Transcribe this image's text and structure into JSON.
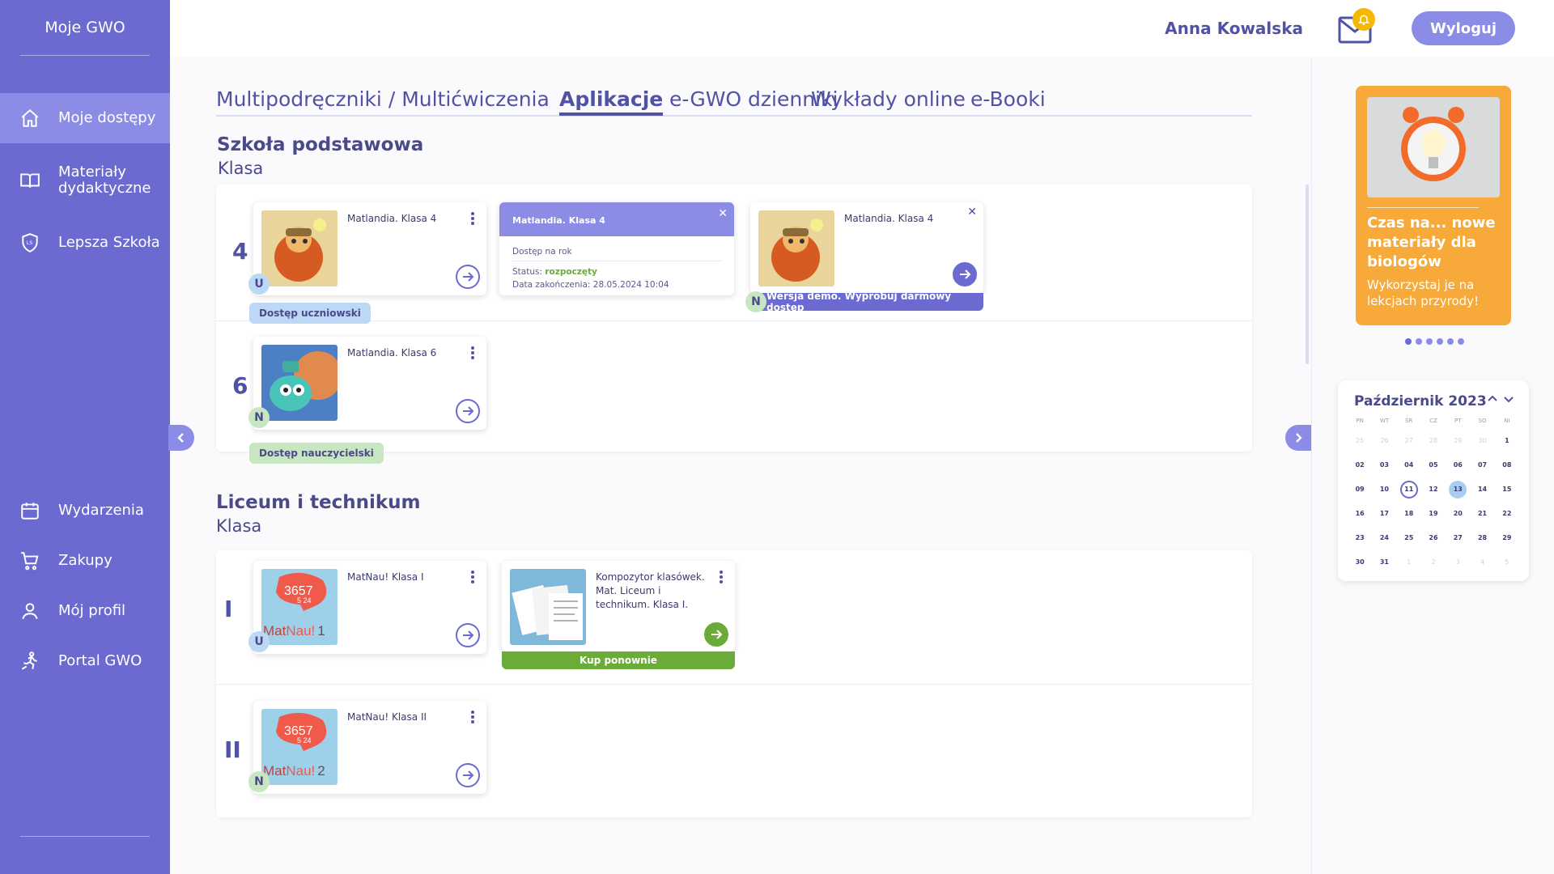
{
  "brand": "Moje GWO",
  "sidebar": {
    "items": [
      {
        "label": "Moje dostępy",
        "icon": "home-icon",
        "active": true
      },
      {
        "label": "Materiały dydaktyczne",
        "icon": "book-icon"
      },
      {
        "label": "Lepsza Szkoła",
        "icon": "shield-icon"
      },
      {
        "label": "Wydarzenia",
        "icon": "calendar-icon"
      },
      {
        "label": "Zakupy",
        "icon": "cart-icon"
      },
      {
        "label": "Mój profil",
        "icon": "user-icon"
      },
      {
        "label": "Portal GWO",
        "icon": "runner-icon"
      }
    ]
  },
  "header": {
    "user_name": "Anna Kowalska",
    "logout_label": "Wyloguj"
  },
  "tabs": [
    {
      "label": "Multipodręczniki / Multićwiczenia"
    },
    {
      "label": "Aplikacje",
      "active": true
    },
    {
      "label": "e-GWO dzienniki"
    },
    {
      "label": "Wykłady online"
    },
    {
      "label": "e-Booki"
    }
  ],
  "sections": {
    "primary": {
      "title": "Szkoła podstawowa",
      "subtitle": "Klasa",
      "rows": [
        {
          "grade": "4",
          "cards": [
            {
              "title": "Matlandia. Klasa 4",
              "letter": "U",
              "badge": "Dostęp uczniowski"
            },
            {
              "title": "Matlandia. Klasa 4",
              "letter": "N",
              "ribbon": "Wersja demo. Wypróbuj darmowy dostęp"
            }
          ],
          "popover": {
            "title": "Matlandia. Klasa 4",
            "access": "Dostęp na rok",
            "status_label": "Status:",
            "status_value": "rozpoczęty",
            "end_label": "Data zakończenia:",
            "end_value": "28.05.2024 10:04"
          }
        },
        {
          "grade": "6",
          "cards": [
            {
              "title": "Matlandia. Klasa 6",
              "letter": "N",
              "badge": "Dostęp  nauczycielski"
            }
          ]
        }
      ]
    },
    "secondary": {
      "title": "Liceum i technikum",
      "subtitle": "Klasa",
      "rows": [
        {
          "grade": "I",
          "cards": [
            {
              "title": "MatNau! Klasa I",
              "letter": "U",
              "thumb_text": {
                "top": "3657",
                "mid": "5 24",
                "brand1": "Mat",
                "brand2": "Nau!",
                "num": "1"
              }
            },
            {
              "title": "Kompozytor klasówek. Mat. Liceum i technikum. Klasa I.",
              "ribbon": "Kup ponownie"
            }
          ]
        },
        {
          "grade": "II",
          "cards": [
            {
              "title": "MatNau! Klasa II",
              "letter": "N",
              "thumb_text": {
                "top": "3657",
                "mid": "5 24",
                "brand1": "Mat",
                "brand2": "Nau!",
                "num": "2"
              }
            }
          ]
        }
      ]
    }
  },
  "promo": {
    "title": "Czas na... nowe materiały dla biologów",
    "text": "Wykorzystaj je na lekcjach przyrody!",
    "dots": 6
  },
  "calendar": {
    "title": "Październik 2023",
    "weekdays": [
      "PN",
      "WT",
      "ŚR",
      "CZ",
      "PT",
      "SO",
      "NI"
    ],
    "days": [
      {
        "d": "25",
        "m": true
      },
      {
        "d": "26",
        "m": true
      },
      {
        "d": "27",
        "m": true
      },
      {
        "d": "28",
        "m": true
      },
      {
        "d": "29",
        "m": true
      },
      {
        "d": "30",
        "m": true
      },
      {
        "d": "1"
      },
      {
        "d": "02"
      },
      {
        "d": "03"
      },
      {
        "d": "04"
      },
      {
        "d": "05"
      },
      {
        "d": "06"
      },
      {
        "d": "07"
      },
      {
        "d": "08"
      },
      {
        "d": "09"
      },
      {
        "d": "10"
      },
      {
        "d": "11",
        "today": true
      },
      {
        "d": "12"
      },
      {
        "d": "13",
        "sel": true
      },
      {
        "d": "14"
      },
      {
        "d": "15"
      },
      {
        "d": "16"
      },
      {
        "d": "17"
      },
      {
        "d": "18"
      },
      {
        "d": "19"
      },
      {
        "d": "20"
      },
      {
        "d": "21"
      },
      {
        "d": "22"
      },
      {
        "d": "23"
      },
      {
        "d": "24"
      },
      {
        "d": "25"
      },
      {
        "d": "26"
      },
      {
        "d": "27"
      },
      {
        "d": "28"
      },
      {
        "d": "29"
      },
      {
        "d": "30"
      },
      {
        "d": "31"
      },
      {
        "d": "1",
        "m": true
      },
      {
        "d": "2",
        "m": true
      },
      {
        "d": "3",
        "m": true
      },
      {
        "d": "4",
        "m": true
      },
      {
        "d": "5",
        "m": true
      }
    ]
  },
  "colors": {
    "sidebar": "#6a6ad1",
    "accent": "#8b8ce6",
    "promo": "#f7a93a",
    "success": "#6aab3a"
  }
}
